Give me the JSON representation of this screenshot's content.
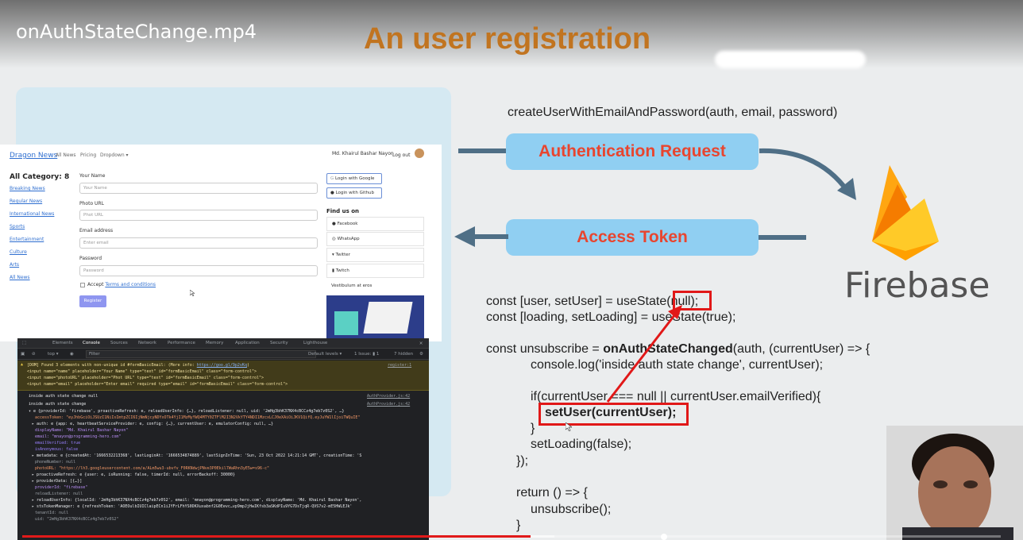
{
  "video": {
    "title": "onAuthStateChange.mp4",
    "progress_percent": 52
  },
  "slide": {
    "title": "An user registration",
    "create_call": "createUserWithEmailAndPassword(auth, email, password)",
    "auth_request_label": "Authentication Request",
    "access_token_label": "Access Token",
    "firebase_label": "Firebase",
    "accent_color": "#c17420",
    "highlight_color": "#e11818",
    "code": {
      "l1a": "const [user, setUser] = useState(",
      "l1b": "null",
      "l1c": ");",
      "l2": "const [loading, setLoading] = useState(true);",
      "l3a": "const unsubscribe = ",
      "l3b": "onAuthStateChanged",
      "l3c": "(auth, (currentUser) => {",
      "l4": "console.log('inside auth state change', currentUser);",
      "l5": "if(currentUser === null || currentUser.emailVerified){",
      "l6": "setUser(currentUser);",
      "l7": "}",
      "l8": "setLoading(false);",
      "l9": "});",
      "l10": "return () => {",
      "l11": "unsubscribe();",
      "l12": "}"
    }
  },
  "browser": {
    "brand": "Dragon News",
    "nav": [
      "All News",
      "Pricing",
      "Dropdown ▾"
    ],
    "user": "Md. Khairul Bashar Nayon",
    "logout": "Log out",
    "category_title": "All Category: 8",
    "categories": [
      "Breaking News",
      "Regular News",
      "International News",
      "Sports",
      "Entertainment",
      "Culture",
      "Arts",
      "All News"
    ],
    "form": {
      "name_label": "Your Name",
      "name_placeholder": "Your Name",
      "photo_label": "Photo URL",
      "photo_placeholder": "Phot URL",
      "email_label": "Email address",
      "email_placeholder": "Enter email",
      "password_label": "Password",
      "password_placeholder": "Password",
      "accept_text": "Accept",
      "terms_link": "Terms and conditions",
      "register_button": "Register"
    },
    "login_google": "Login with Google",
    "login_github": "Login with Github",
    "find_us": "Find us on",
    "social": [
      "Facebook",
      "WhatsApp",
      "Twitter",
      "Twitch",
      "Vestibulum at eros"
    ]
  },
  "devtools": {
    "tabs": [
      "Elements",
      "Console",
      "Sources",
      "Network",
      "Performance",
      "Memory",
      "Application",
      "Security",
      "Lighthouse"
    ],
    "active_tab": "Console",
    "context": "top ▾",
    "filter_placeholder": "Filter",
    "levels": "Default levels ▾",
    "issue_count": "1 Issue: ▮ 1",
    "hidden_count": "7 hidden",
    "warning": {
      "line1": "[DOM] Found 3 elements with non-unique id #formBasicEmail: (More info: ",
      "link": "https://goo.gl/9p2vKq",
      "line2": "<input name=\"name\" placeholder=\"Your Name\" type=\"text\" id=\"formBasicEmail\" class=\"form-control\">",
      "line3": "<input name=\"photoURL\" placeholder=\"Phot URL\" type=\"text\" id=\"formBasicEmail\" class=\"form-control\">",
      "line4": "<input name=\"email\" placeholder=\"Enter email\" required type=\"email\" id=\"formBasicEmail\" class=\"form-control\">",
      "source": "register:1"
    },
    "log1": "inside auth state change null",
    "log1_src": "AuthProvider.js:42",
    "log2": "inside auth state change",
    "log2_src": "AuthProvider.js:42",
    "lines": [
      "▾ e {providerId: 'firebase', proactiveRefresh: e, reloadUserInfo: {…}, reloadListener: null, uid: '2mHg3bhK37NX4cBCCz4g7eb7z0S2', …}",
      "accessToken: \"eyJhbGciOiJSUzI1NiIsImtpZCI6IjNmNjcyNDYxOTk4YjI1MzMyYWQ4MTY0ZTFlM2I3N2VkYTY4NDI1MzcxLCJ0eXAiOiJKV1QifQ.eyJuYW1lIjoiTWQuIE\"",
      "▸ auth: e {app: e, heartbeatServiceProvider: e, config: {…}, currentUser: e, emulatorConfig: null, …}",
      "displayName: \"Md. Khairul Bashar Nayon\"",
      "email: \"mnayon@programming-hero.com\"",
      "emailVerified: true",
      "isAnonymous: false",
      "▸ metadata: e {createdAt: '1666532213368', lastLoginAt: '1666534874889', lastSignInTime: 'Sun, 23 Oct 2022 14:21:14 GMT', creationTime: 'S",
      "phoneNumber: null",
      "photoURL: \"https://lh3.googleusercontent.com/a/ALm5wu3-ubvfv_F0RKNdwjPNve3P0Ekil7WaRhn3yE5w=s96-c\"",
      "▸ proactiveRefresh: e {user: e, isRunning: false, timerId: null, errorBackoff: 30000}",
      "▸ providerData: [{…}]",
      "providerId: \"firebase\"",
      "reloadListener: null",
      "▸ reloadUserInfo: {localId: '2mHg3bhK37NX4cBCCz4g7eb7z0S2', email: 'mnayon@programming-hero.com', displayName: 'Md. Khairul Bashar Nayon',",
      "▸ stsTokenManager: e {refreshToken: 'AOEOulbIUIClaipECn1iJYFrLFhYS0DKXuxabnf2G0Eevc…vp9mpJjHwIKfsb3aSKdPIu9YG7DsTjqR-QVS7v2-mE5HWLEJk'",
      "tenantId: null",
      "uid: \"2mHg3bhK37NX4cBCCz4g7eb7z0S2\""
    ]
  }
}
